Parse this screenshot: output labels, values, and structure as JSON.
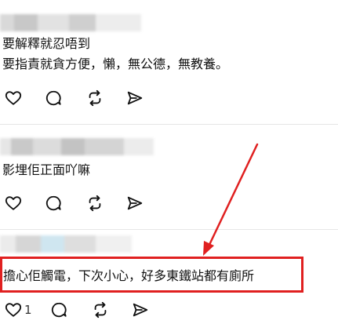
{
  "replies": [
    {
      "lines": [
        "要解釋就忍唔到",
        "要指責就貪方便，懶，無公德，無教養。"
      ],
      "like_count": ""
    },
    {
      "lines": [
        "影埋佢正面吖嘛"
      ],
      "like_count": ""
    },
    {
      "lines": [
        "擔心佢觸電，下次小心，好多東鐵站都有廁所"
      ],
      "like_count": "1"
    }
  ],
  "icons": [
    "heart-icon",
    "comment-icon",
    "repost-icon",
    "share-icon"
  ],
  "colors": {
    "annotation_red": "#e02020",
    "divider": "#e6e6e6",
    "text": "#111111"
  }
}
